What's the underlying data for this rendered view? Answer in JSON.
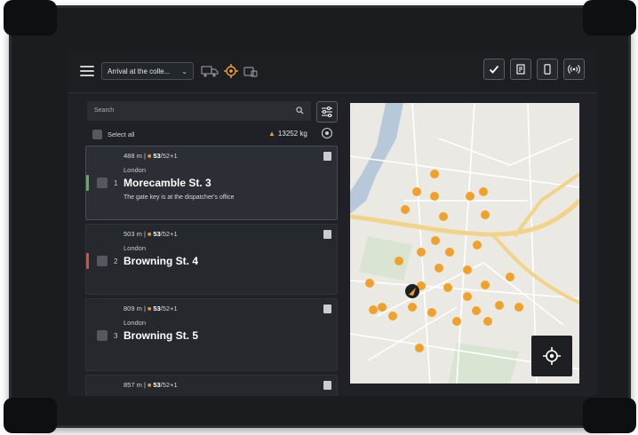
{
  "header": {
    "route_dropdown_value": "Arrival at the colle...",
    "icons": [
      "menu-icon",
      "truck-icon",
      "crosshair-icon",
      "vehicle-icon"
    ],
    "right_buttons": [
      "check-icon",
      "document-edit-icon",
      "phone-icon",
      "broadcast-icon"
    ],
    "accent_color": "#f0a12a"
  },
  "search": {
    "placeholder": "Search"
  },
  "select_all_label": "Select all",
  "total_weight": "13252 kg",
  "stops": [
    {
      "distance": "488 m",
      "qty_main": "53",
      "qty_rest": "/52+1",
      "city": "London",
      "index": "1",
      "street": "Morecamble St. 3",
      "note": "The gate key is at the dispatcher's office",
      "status_color": "#59b54a"
    },
    {
      "distance": "503 m",
      "qty_main": "53",
      "qty_rest": "/52+1",
      "city": "London",
      "index": "2",
      "street": "Browning St. 4",
      "note": "",
      "status_color": "#e04a3f"
    },
    {
      "distance": "809 m",
      "qty_main": "53",
      "qty_rest": "/52+1",
      "city": "London",
      "index": "3",
      "street": "Browning St. 5",
      "note": "",
      "status_color": ""
    },
    {
      "distance": "857 m",
      "qty_main": "53",
      "qty_rest": "/52+1",
      "city": "",
      "index": "",
      "street": "",
      "note": "",
      "status_color": ""
    }
  ],
  "map": {
    "marker_color": "#f0a12a",
    "locate_button_icon": "crosshair-icon"
  }
}
